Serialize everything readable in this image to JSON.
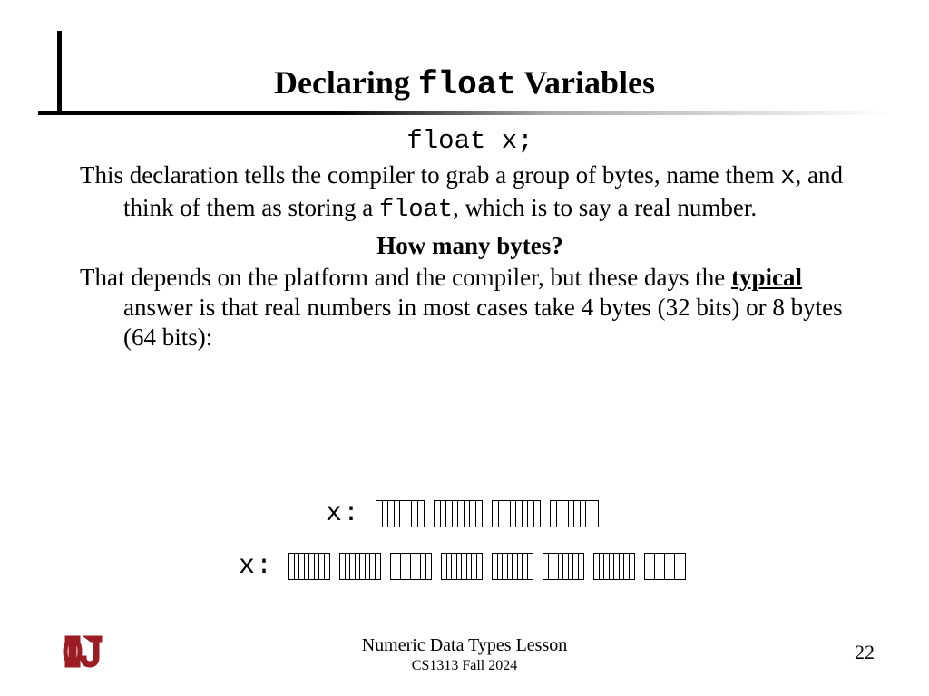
{
  "title": {
    "pre": "Declaring ",
    "code": "float",
    "post": " Variables"
  },
  "code_decl": "float x;",
  "para1": {
    "t1": "This declaration tells the compiler to grab a group of bytes, name them  ",
    "c1": "x",
    "t2": ", and think of them as storing a  ",
    "c2": "float",
    "t3": ", which is to say a real number."
  },
  "subhead": "How many bytes?",
  "para2": {
    "t1": "That depends on the platform and the compiler, but these days the ",
    "b1": "typical",
    "t2": " answer is that real numbers in most cases take 4 bytes (32 bits) or 8 bytes (64 bits):"
  },
  "byte_label": "x:",
  "footer": {
    "lesson": "Numeric Data Types Lesson",
    "course": "CS1313 Fall 2024",
    "page": "22"
  },
  "logo_letters": "OU",
  "colors": {
    "logo": "#9b1c23"
  }
}
